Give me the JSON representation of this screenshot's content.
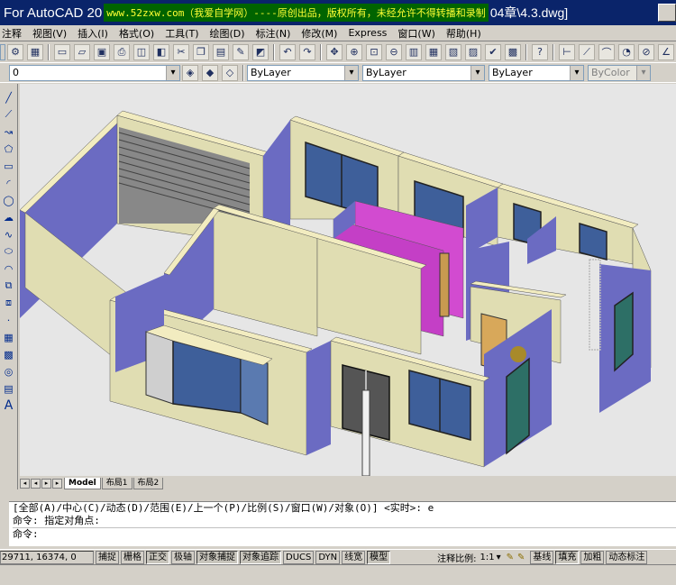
{
  "titlebar": {
    "app_title": "For AutoCAD 20",
    "watermark": "www.52zxw.com（我爱自学网）----原创出品，版权所有，未经允许不得转播和录制",
    "file": "04章\\4.3.dwg]"
  },
  "menu": [
    "视图(V)",
    "插入(I)",
    "格式(O)",
    "工具(T)",
    "绘图(D)",
    "标注(N)",
    "修改(M)",
    "Express",
    "窗口(W)",
    "帮助(H)"
  ],
  "menu_partial": "注释",
  "toolbar": {
    "workspace_value": "注释",
    "layer_value": "0",
    "color_value": "ByLayer",
    "linetype_value": "ByLayer",
    "lineweight_value": "ByLayer",
    "plotstyle_value": "ByColor"
  },
  "tabs": [
    "Model",
    "布局1",
    "布局2"
  ],
  "command": {
    "line1": "[全部(A)/中心(C)/动态(D)/范围(E)/上一个(P)/比例(S)/窗口(W)/对象(O)] <实时>: e",
    "line2": "命令: 指定对角点:",
    "line3": "命令:"
  },
  "status": {
    "coords": "29711, 16374, 0",
    "buttons": [
      "捕捉",
      "栅格",
      "正交",
      "极轴",
      "对象捕捉",
      "对象追踪",
      "DUCS",
      "DYN",
      "线宽",
      "模型"
    ],
    "annotation_scale_label": "注释比例:",
    "annotation_scale_value": "1:1",
    "right_buttons": [
      "基线",
      "填充",
      "加粗",
      "动态标注"
    ]
  },
  "colors": {
    "title_bg": "#0a246a",
    "watermark_bg": "#006400",
    "watermark_fg": "#ffff33",
    "wall_top": "#f2ecc0",
    "wall_side": "#e0ddb2",
    "wall_inner": "#6b6bc2",
    "wall_magenta": "#d24bd0",
    "glass": "#3e5f9a"
  }
}
